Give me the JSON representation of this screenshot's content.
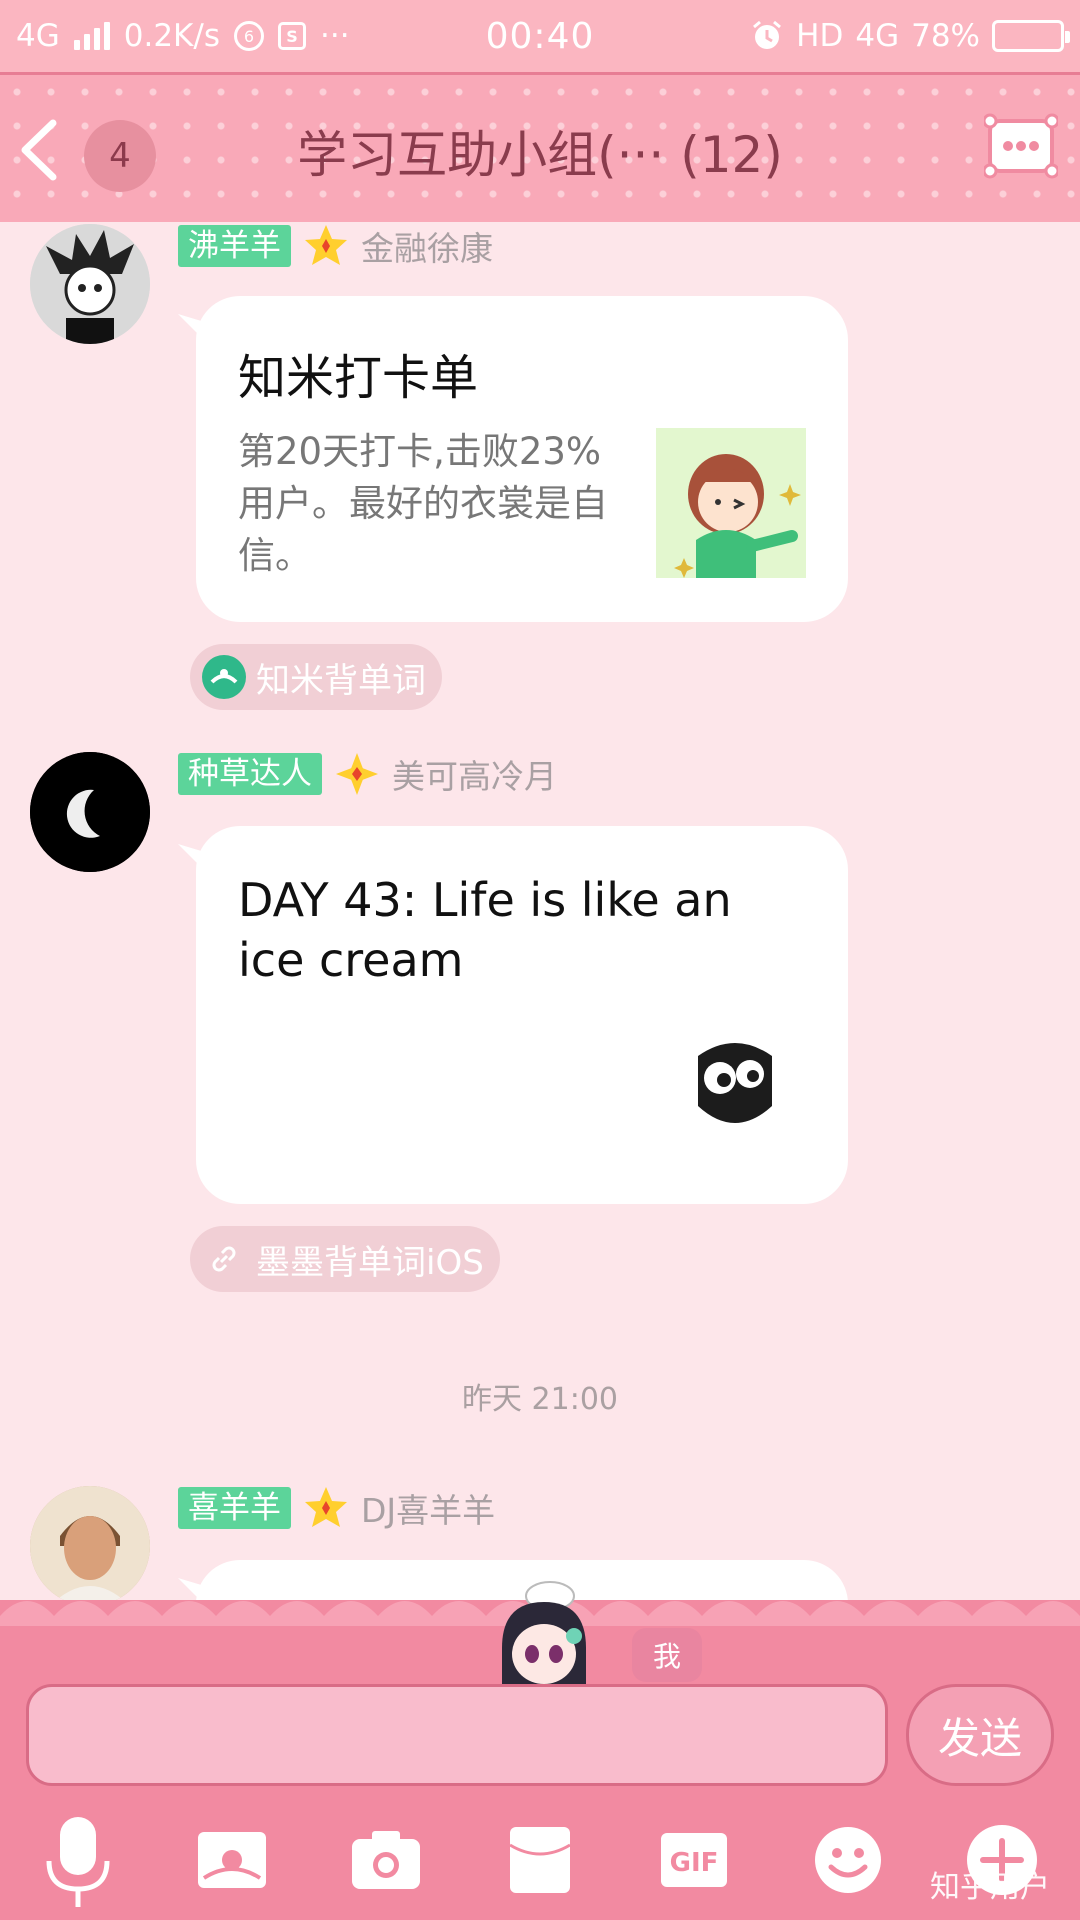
{
  "status_bar": {
    "network": "4G",
    "speed": "0.2K/s",
    "more": "···",
    "time": "00:40",
    "hd": "HD",
    "net_right": "4G",
    "battery": "78%",
    "battery_level": 0.78
  },
  "header": {
    "unread_count": "4",
    "title": "学习互助小组(··· (12)"
  },
  "messages": [
    {
      "rank": "沸羊羊",
      "name": "金融徐康",
      "card_title": "知米打卡单",
      "card_desc": "第20天打卡,击败23%用户。最好的衣裳是自信。",
      "source": "知米背单词"
    },
    {
      "rank": "种草达人",
      "name": "美可高冷月",
      "card_text": "DAY 43: Life is like an ice cream",
      "source": "墨墨背单词iOS"
    },
    {
      "rank": "喜羊羊",
      "name": "DJ喜羊羊"
    }
  ],
  "timestamp": "昨天 21:00",
  "composer": {
    "me_label": "我",
    "input_value": "",
    "send_label": "发送"
  },
  "toolbar": {
    "gif_label": "GIF",
    "icons": [
      "microphone-icon",
      "landscape-icon",
      "camera-icon",
      "envelope-icon",
      "gif-icon",
      "smiley-icon",
      "plus-icon"
    ]
  },
  "watermark": "知乎用户",
  "colors": {
    "rank_badge": "#5cd49a",
    "header_bg": "#f9a9b8",
    "panel_bg": "#f28aa1",
    "chat_bg": "#fde6ea"
  }
}
